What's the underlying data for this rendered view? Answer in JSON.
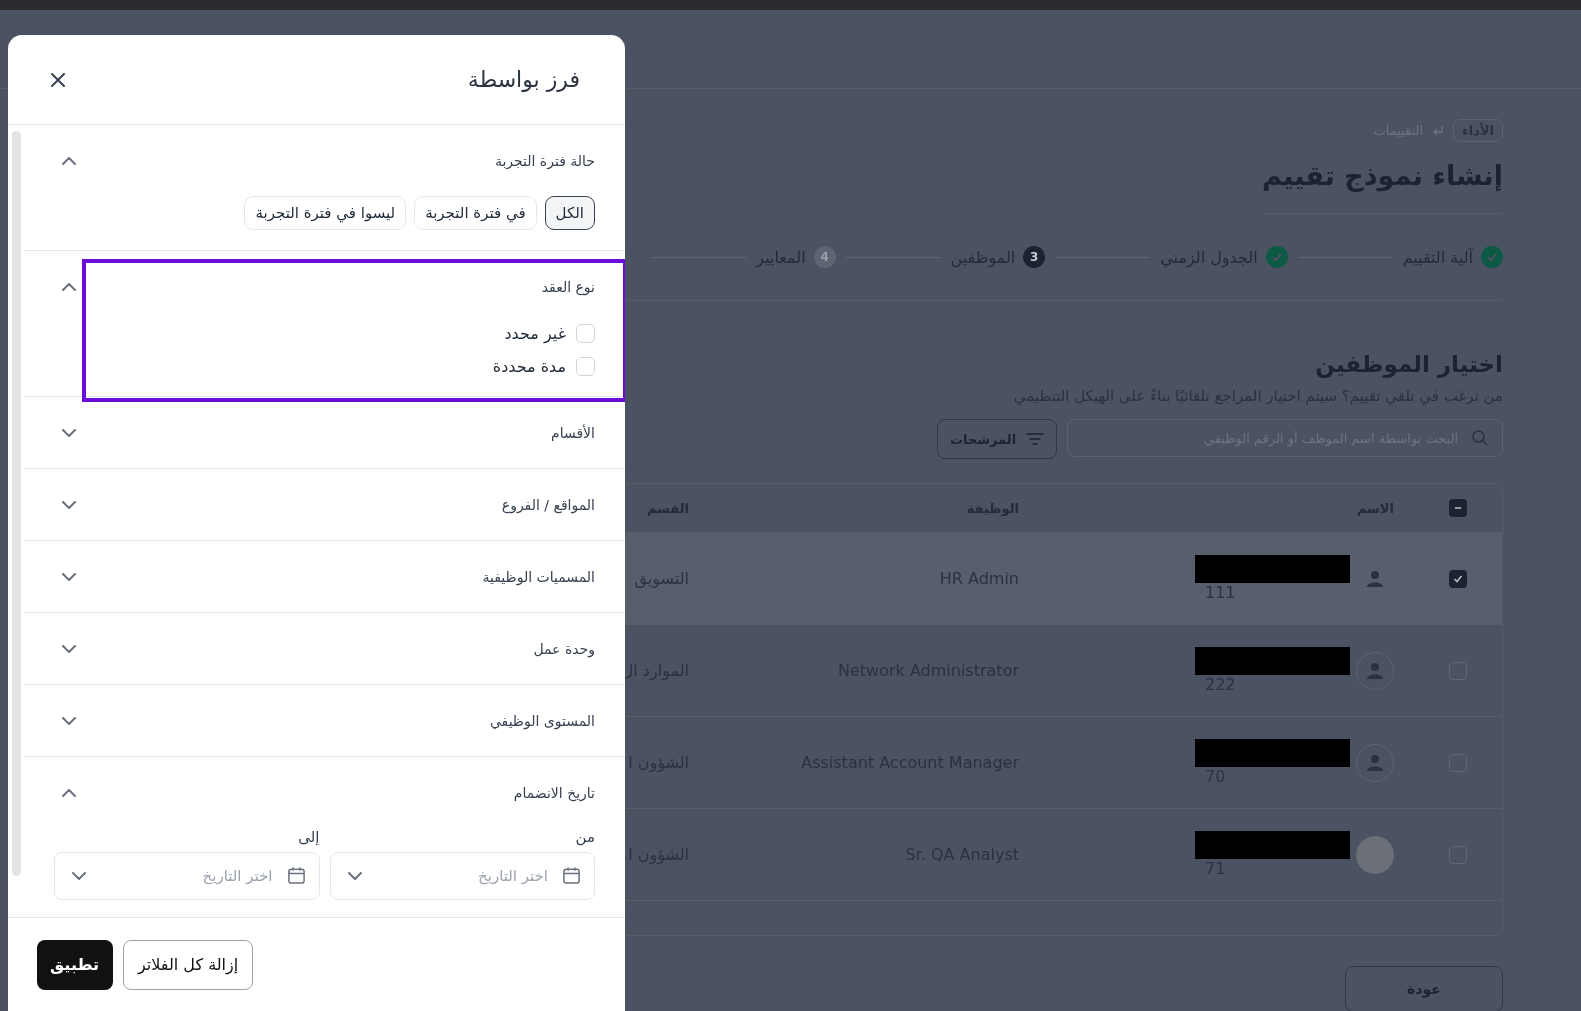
{
  "breadcrumb": [
    {
      "label": "الأداء",
      "kind": "chip"
    },
    {
      "label": "التقييمات",
      "kind": "link"
    }
  ],
  "page_title": "إنشاء نموذج تقييم",
  "steps": [
    {
      "label": "آلية التقييم",
      "kind": "done"
    },
    {
      "label": "الجدول الزمني",
      "kind": "done"
    },
    {
      "label": "الموظفين",
      "kind": "current",
      "number": "3"
    },
    {
      "label": "المعايير",
      "kind": "upcoming",
      "number": "4"
    }
  ],
  "section": {
    "title": "اختيار الموظفين",
    "description": "من ترغب في تلقي تقييم؟ سيتم اختيار المراجع تلقائيًا بناءً على الهيكل التنظيمي"
  },
  "search": {
    "placeholder": "البحث بواسطة اسم الموظف أو الرقم الوظيفي"
  },
  "filters_button": "المرشحات",
  "table": {
    "select_all": {
      "indeterminate": true
    },
    "columns": [
      "الاسم",
      "الوظيفة",
      "القسم"
    ],
    "rows": [
      {
        "selected": true,
        "kind": "placeholder",
        "employee_number": "111",
        "job": "HR Admin",
        "department": "التسويق"
      },
      {
        "selected": false,
        "kind": "placeholder",
        "employee_number": "222",
        "job": "Network Administrator",
        "department": "الموارد ال"
      },
      {
        "selected": false,
        "kind": "placeholder",
        "employee_number": "70",
        "job": "Assistant Account Manager",
        "department": "الشؤون ا"
      },
      {
        "selected": false,
        "kind": "photo",
        "employee_number": "71",
        "job": "Sr. QA Analyst",
        "department": "الشؤون ا"
      }
    ]
  },
  "back_button": "عودة",
  "drawer": {
    "title": "فرز بواسطة",
    "groups": [
      {
        "title": "حالة فترة التجربة",
        "expanded": true,
        "kind": "segments",
        "options": [
          {
            "label": "الكل",
            "selected": true
          },
          {
            "label": "في فترة التجربة",
            "selected": false
          },
          {
            "label": "ليسوا في فترة التجربة",
            "selected": false
          }
        ]
      },
      {
        "title": "نوع العقد",
        "expanded": true,
        "kind": "checkboxes",
        "highlighted": true,
        "options": [
          {
            "label": "غير محدد",
            "checked": false
          },
          {
            "label": "مدة محددة",
            "checked": false
          }
        ]
      },
      {
        "title": "الأقسام",
        "expanded": false
      },
      {
        "title": "المواقع / الفروع",
        "expanded": false
      },
      {
        "title": "المسميات الوظيفية",
        "expanded": false
      },
      {
        "title": "وحدة عمل",
        "expanded": false
      },
      {
        "title": "المستوى الوظيفي",
        "expanded": false
      },
      {
        "title": "تاريخ الانضمام",
        "expanded": true,
        "kind": "date_range",
        "fields": [
          {
            "label": "من",
            "placeholder": "اختر التاريخ"
          },
          {
            "label": "إلى",
            "placeholder": "اختر التاريخ"
          }
        ]
      }
    ],
    "buttons": [
      {
        "label": "إزالة كل الفلاتر",
        "kind": "secondary"
      },
      {
        "label": "تطبيق",
        "kind": "primary"
      }
    ]
  }
}
